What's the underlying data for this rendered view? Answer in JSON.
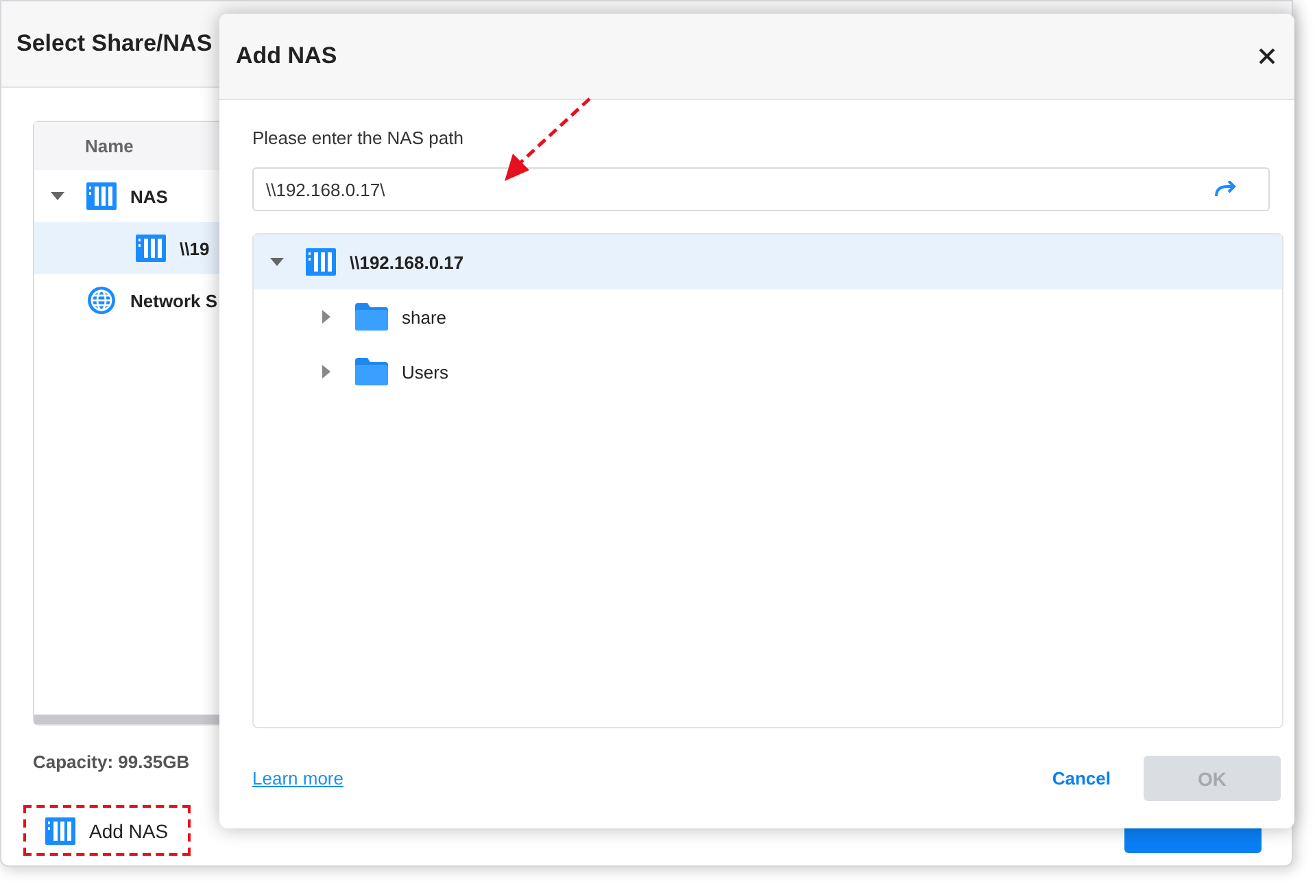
{
  "window": {
    "title": "Select Share/NAS",
    "tree": {
      "columns": [
        "Name"
      ],
      "items": [
        {
          "label": "NAS",
          "kind": "nas",
          "expanded": true,
          "selected": false,
          "children": [
            {
              "label": "\\\\19",
              "kind": "nas",
              "selected": true
            }
          ]
        },
        {
          "label": "Network S",
          "kind": "share",
          "selected": false
        }
      ]
    },
    "capacity": "Capacity: 99.35GB",
    "actions": [
      {
        "label": "Add NAS",
        "kind": "nas",
        "highlighted": true
      }
    ],
    "buttons": [
      {
        "kind": "primary",
        "disabled": false
      }
    ]
  },
  "dialog": {
    "title": "Add NAS",
    "path_label": "Please enter the NAS path",
    "path_field": {
      "value": "\\\\192.168.0.17\\"
    },
    "tree": [
      {
        "label": "\\\\192.168.0.17",
        "kind": "nas",
        "expanded": true,
        "selected": true,
        "children": [
          {
            "label": "share",
            "kind": "folder",
            "expanded": false,
            "selected": false
          },
          {
            "label": "Users",
            "kind": "folder",
            "expanded": false,
            "selected": false
          }
        ]
      }
    ],
    "learn_more": "Learn more",
    "buttons": [
      {
        "label": "Cancel",
        "kind": "link"
      },
      {
        "label": "OK",
        "kind": "primary",
        "disabled": true
      }
    ]
  }
}
